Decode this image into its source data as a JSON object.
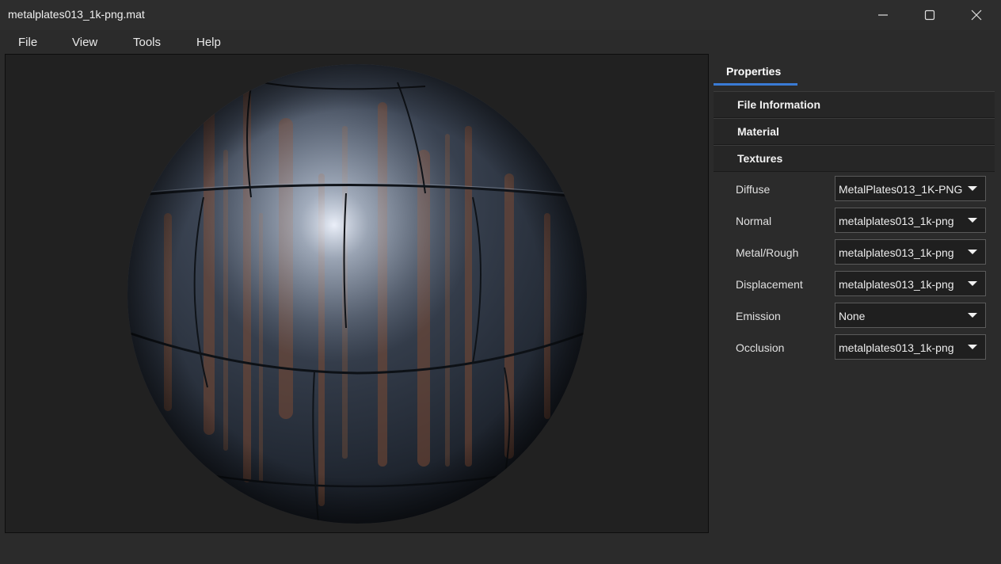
{
  "window": {
    "title": "metalplates013_1k-png.mat",
    "minimize_icon": "minimize-icon",
    "maximize_icon": "maximize-icon",
    "close_icon": "close-icon"
  },
  "menu": {
    "file": "File",
    "view": "View",
    "tools": "Tools",
    "help": "Help"
  },
  "viewport": {
    "background_color": "#212121"
  },
  "properties": {
    "tab_label": "Properties",
    "accent_color": "#3a7bd5",
    "sections": [
      {
        "label": "File Information",
        "expanded": false
      },
      {
        "label": "Material",
        "expanded": false
      },
      {
        "label": "Textures",
        "expanded": true
      }
    ],
    "textures": [
      {
        "label": "Diffuse",
        "value": "MetalPlates013_1K-PNG"
      },
      {
        "label": "Normal",
        "value": "metalplates013_1k-png"
      },
      {
        "label": "Metal/Rough",
        "value": "metalplates013_1k-png"
      },
      {
        "label": "Displacement",
        "value": "metalplates013_1k-png"
      },
      {
        "label": "Emission",
        "value": "None"
      },
      {
        "label": "Occlusion",
        "value": "metalplates013_1k-png"
      }
    ]
  }
}
